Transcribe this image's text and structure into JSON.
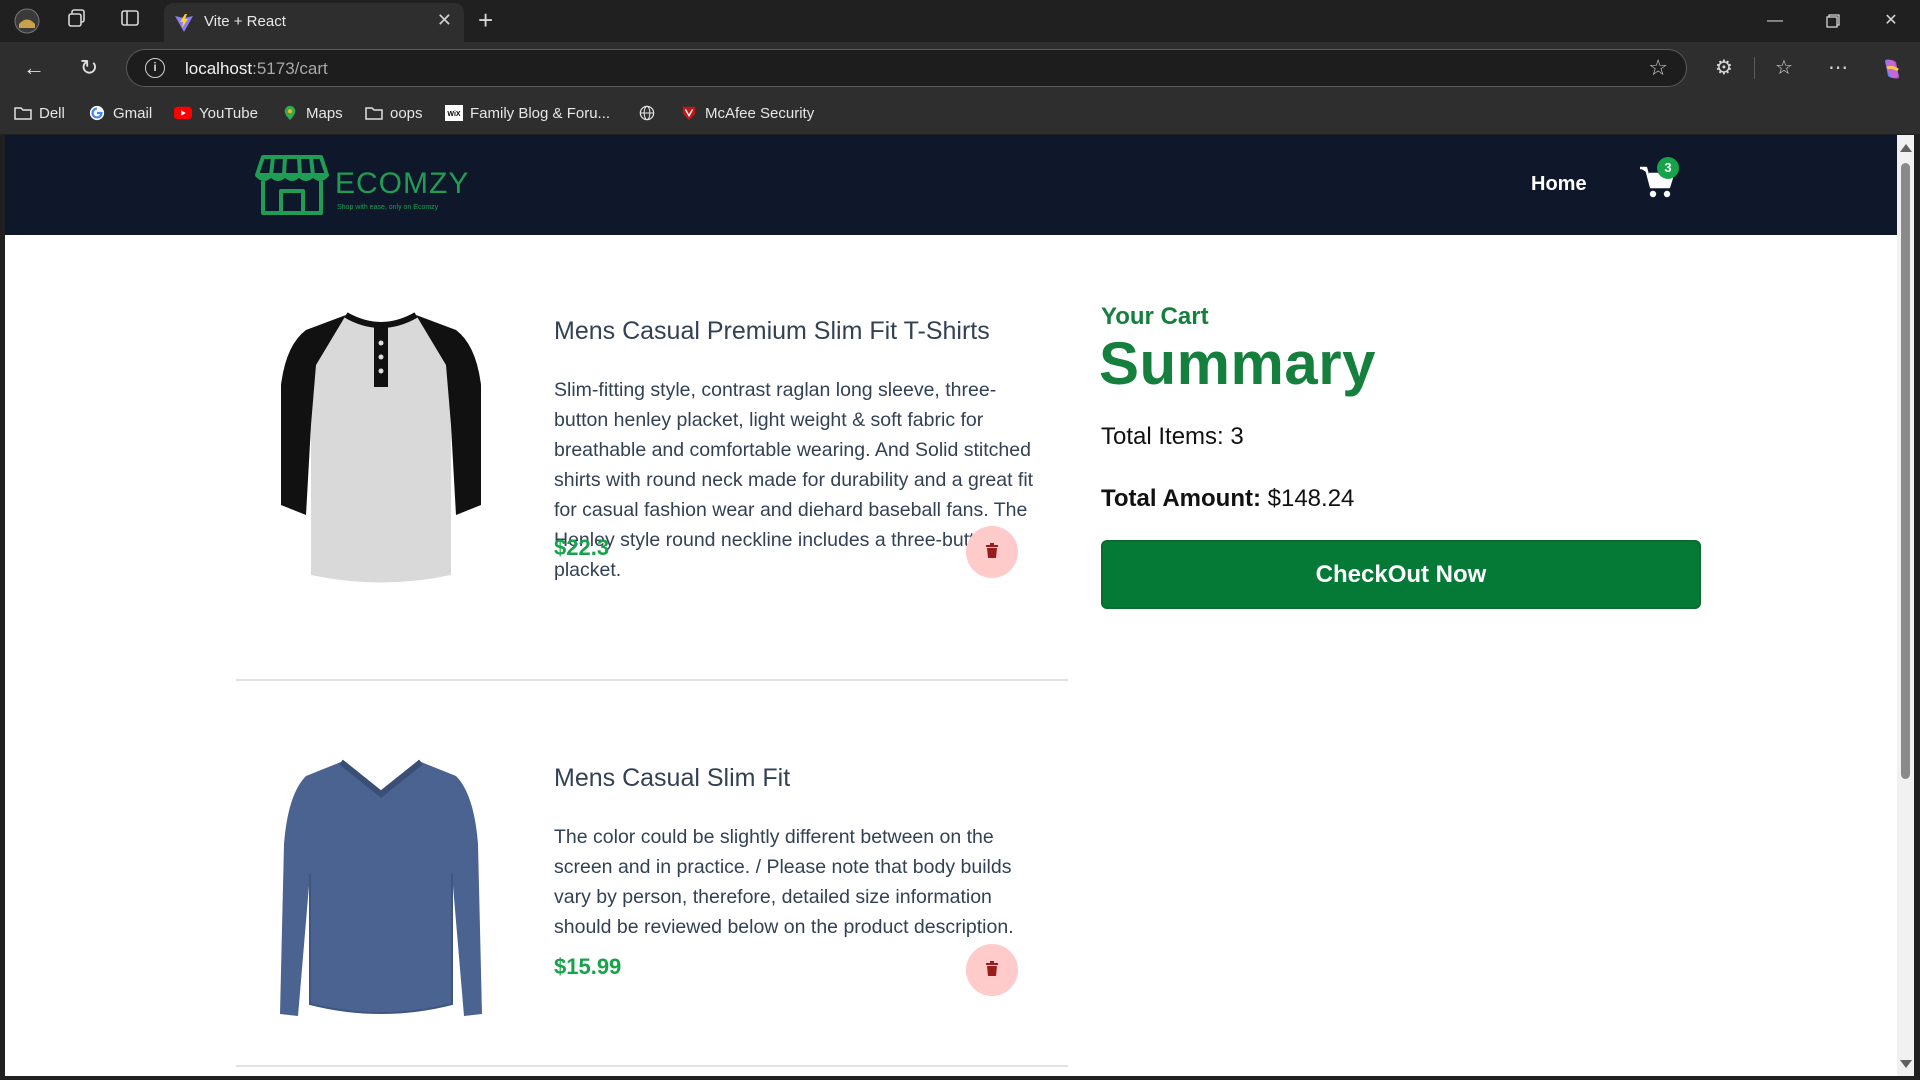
{
  "browser": {
    "tab_title": "Vite + React",
    "url_host": "localhost",
    "url_path": ":5173/cart",
    "bookmarks": [
      {
        "label": "Dell",
        "icon": "folder-icon"
      },
      {
        "label": "Gmail",
        "icon": "google-icon"
      },
      {
        "label": "YouTube",
        "icon": "youtube-icon"
      },
      {
        "label": "Maps",
        "icon": "maps-pin-icon"
      },
      {
        "label": "oops",
        "icon": "folder-icon"
      },
      {
        "label": "Family Blog & Foru...",
        "icon": "wix-icon"
      },
      {
        "label": "",
        "icon": "globe-icon"
      },
      {
        "label": "McAfee Security",
        "icon": "mcafee-icon"
      }
    ]
  },
  "header": {
    "logo_text": "ECOMZY",
    "logo_tagline": "Shop with ease, only on Ecomzy",
    "home_label": "Home",
    "cart_count": "3"
  },
  "items": [
    {
      "title": "Mens Casual Premium Slim Fit T-Shirts",
      "description": "Slim-fitting style, contrast raglan long sleeve, three-button henley placket, light weight & soft fabric for breathable and comfortable wearing. And Solid stitched shirts with round neck made for durability and a great fit for casual fashion wear and diehard baseball fans. The Henley style round neckline includes a three-button placket.",
      "price": "$22.3"
    },
    {
      "title": "Mens Casual Slim Fit",
      "description": "The color could be slightly different between on the screen and in practice. / Please note that body builds vary by person, therefore, detailed size information should be reviewed below on the product description.",
      "price": "$15.99"
    }
  ],
  "summary": {
    "label": "Your Cart",
    "title": "Summary",
    "items_label": "Total Items: 3",
    "amount_label": "Total Amount:",
    "amount_value": "$148.24",
    "checkout_label": "CheckOut Now"
  },
  "colors": {
    "navbar": "#0f172a",
    "accent_green": "#15803d",
    "price_green": "#16a34a",
    "checkout_bg": "#047a36",
    "delete_bg": "#fecaca",
    "delete_icon": "#991b1b"
  }
}
